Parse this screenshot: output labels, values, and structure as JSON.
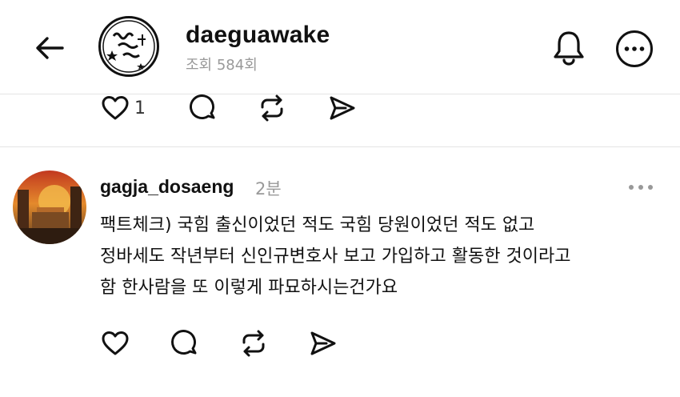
{
  "header": {
    "account_name": "daeguawake",
    "view_count": "조회 584회",
    "logo_icon": "daeguawake-logo-icon",
    "back_icon": "arrow-left-icon",
    "bell_icon": "bell-icon",
    "more_icon": "more-circle-icon"
  },
  "post_actions": {
    "like_count": "1",
    "icons": [
      "heart-icon",
      "comment-icon",
      "repost-icon",
      "share-icon"
    ]
  },
  "comment": {
    "username": "gagja_dosaeng",
    "time": "2분",
    "lines": [
      "팩트체크) 국힘 출신이었던 적도 국힘 당원이었던 적도 없고",
      "정바세도 작년부터 신인규변호사 보고 가입하고 활동한 것이라고",
      "함 한사람을 또 이렇게 파묘하시는건가요"
    ],
    "more_icon": "more-dots-icon",
    "actions": [
      "heart-icon",
      "comment-icon",
      "repost-icon",
      "share-icon"
    ]
  }
}
